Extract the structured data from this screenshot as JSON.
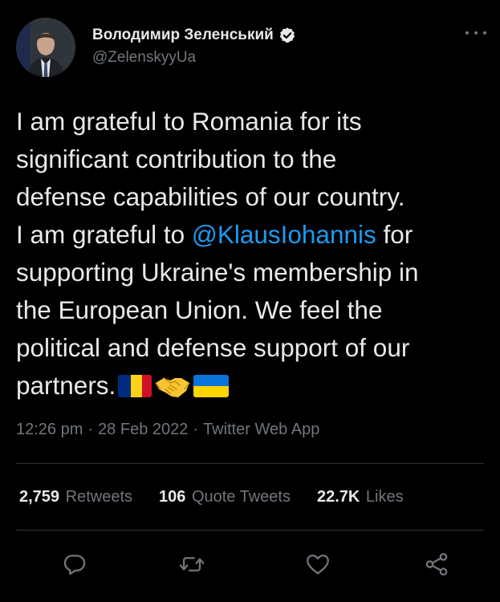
{
  "author": {
    "display_name": "Володимир Зеленський",
    "handle": "@ZelenskyyUa",
    "verified": true
  },
  "tweet": {
    "lines": [
      [
        "I am grateful to Romania for its"
      ],
      [
        "significant contribution to the"
      ],
      [
        "defense capabilities of our country."
      ],
      [
        "I am grateful to ",
        "@KlausIohannis",
        " for"
      ],
      [
        "supporting Ukraine's membership in"
      ],
      [
        "the European Union. We feel the"
      ],
      [
        "political and defense support of our"
      ],
      [
        "partners."
      ]
    ],
    "mention": "@KlausIohannis",
    "emojis": [
      "flag-romania",
      "handshake",
      "flag-ukraine"
    ]
  },
  "meta": {
    "time": "12:26 pm",
    "date": "28 Feb 2022",
    "source": "Twitter Web App",
    "separator": "·"
  },
  "stats": {
    "retweets": {
      "count": "2,759",
      "label": "Retweets"
    },
    "quote_tweets": {
      "count": "106",
      "label": "Quote Tweets"
    },
    "likes": {
      "count": "22.7K",
      "label": "Likes"
    }
  },
  "actions": [
    {
      "name": "reply-icon"
    },
    {
      "name": "retweet-icon"
    },
    {
      "name": "like-icon"
    },
    {
      "name": "share-icon"
    }
  ],
  "colors": {
    "background": "#000000",
    "text": "#e7e9ea",
    "secondary": "#71767b",
    "accent": "#1d9bf0",
    "divider": "#2f3336"
  }
}
